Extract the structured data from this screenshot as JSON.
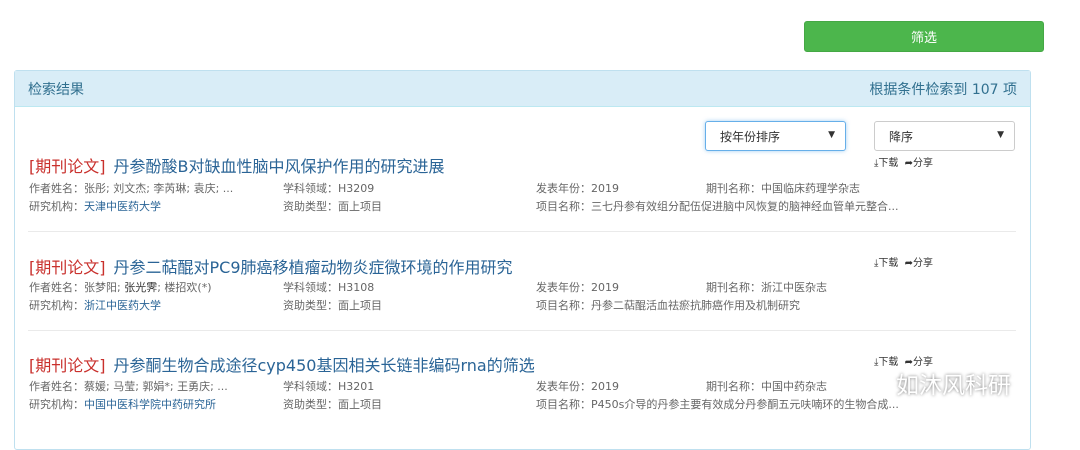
{
  "toolbar": {
    "filter_label": "筛选"
  },
  "panel": {
    "title": "检索结果",
    "count_text": "根据条件检索到 107 项"
  },
  "sort": {
    "field_selected": "按年份排序",
    "order_selected": "降序"
  },
  "actions": {
    "download": "下载",
    "share": "分享"
  },
  "labels": {
    "authors": "作者姓名：",
    "subject": "学科领域：",
    "year": "发表年份：",
    "journal": "期刊名称：",
    "institution": "研究机构：",
    "funding": "资助类型：",
    "project": "项目名称："
  },
  "results": [
    {
      "tag": "[期刊论文]",
      "title": "丹参酚酸B对缺血性脑中风保护作用的研究进展",
      "authors": "张彤; 刘文杰; 李芮琳; 袁庆; ...",
      "subject": "H3209",
      "year": "2019",
      "journal": "中国临床药理学杂志",
      "institution": "天津中医药大学",
      "funding": "面上项目",
      "project": "三七丹参有效组分配伍促进脑中风恢复的脑神经血管单元整合..."
    },
    {
      "tag": "[期刊论文]",
      "title": "丹参二萜醌对PC9肺癌移植瘤动物炎症微环境的作用研究",
      "authors_a": "张梦阳; ",
      "authors_b": "张光霁",
      "authors_c": "; 楼招欢(*)",
      "subject": "H3108",
      "year": "2019",
      "journal": "浙江中医杂志",
      "institution": "浙江中医药大学",
      "funding": "面上项目",
      "project": "丹参二萜醌活血祛瘀抗肺癌作用及机制研究"
    },
    {
      "tag": "[期刊论文]",
      "title": "丹参酮生物合成途径cyp450基因相关长链非编码rna的筛选",
      "authors": "蔡媛; 马莹; 郭娟*; 王勇庆; ...",
      "subject": "H3201",
      "year": "2019",
      "journal": "中国中药杂志",
      "institution": "中国中医科学院中药研究所",
      "funding": "面上项目",
      "project": "P450s介导的丹参主要有效成分丹参酮五元呋喃环的生物合成..."
    }
  ],
  "watermark": {
    "text": "如沐风科研"
  }
}
